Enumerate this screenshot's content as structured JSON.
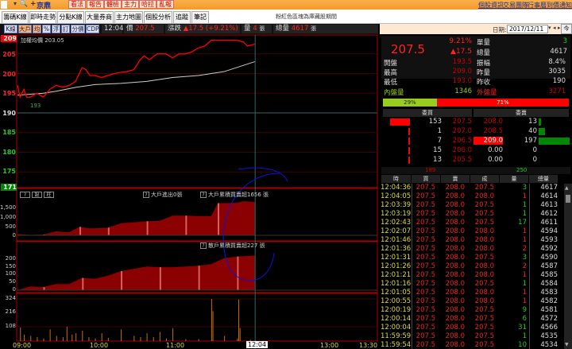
{
  "topbar": {
    "stock_name": "京鼎",
    "buttons": [
      "看法",
      "報告",
      "體檢",
      "主力",
      "哈拉",
      "亂報"
    ],
    "links": [
      "個股資訊",
      "交易團隊",
      "行事曆",
      "到價通知"
    ]
  },
  "tabs": [
    "籌碼K線",
    "即時走勢",
    "分點K線",
    "大量券商",
    "主力地圖",
    "個股分析",
    "追蹤",
    "筆記"
  ],
  "active_tab": 1,
  "notice": "粉紅色區塊為庫藏股期間",
  "toolbar": {
    "buttons": [
      "K線",
      "大戶",
      "均",
      "%",
      "浮",
      "訂",
      "分價",
      "CDP"
    ],
    "active": [
      1,
      2
    ],
    "time": "12:04",
    "price_label": "價",
    "price": "207.5",
    "change_label": "漲跌",
    "change": "▲17.5 (+9.21%)",
    "vol_label": "量",
    "vol": "4",
    "vol_unit": "張",
    "total_label": "總量",
    "total": "4617",
    "total_unit": "張"
  },
  "price_chart": {
    "avg_label": "加權均價 203.05",
    "low_marker": "193",
    "y_labels": {
      "top": "209",
      "l205": "205",
      "l200": "200",
      "l195": "195",
      "ref": "190",
      "l185": "185",
      "l180": "180",
      "l175": "175",
      "bottom": "171"
    },
    "x": [
      0,
      2,
      5,
      7,
      10,
      15,
      20,
      25,
      30,
      35,
      40,
      45,
      50,
      53,
      56,
      60,
      65,
      70,
      75,
      80,
      85,
      90,
      95,
      98,
      102,
      108,
      115,
      120,
      125,
      130,
      135,
      140,
      145,
      150,
      160,
      170,
      175,
      178,
      184
    ],
    "price": [
      197,
      194,
      196,
      194,
      194,
      195,
      194,
      196,
      197,
      196.5,
      197,
      198,
      201.5,
      201,
      199.5,
      199.5,
      199,
      199.5,
      200,
      200.3,
      200.5,
      201,
      203.5,
      204.5,
      203.5,
      205,
      205,
      204,
      205,
      205,
      205.5,
      206.5,
      207,
      208.5,
      208.5,
      208.5,
      208,
      207,
      207.5
    ],
    "avg_x": [
      0,
      20,
      30,
      45,
      60,
      80,
      100,
      120,
      140,
      160,
      184
    ],
    "avg": [
      194.5,
      195,
      195.5,
      196.5,
      197.2,
      197.5,
      198,
      199,
      199.5,
      200.5,
      203.05
    ]
  },
  "panel_buttons": [
    "?",
    "設",
    "柱"
  ],
  "big_trader": {
    "inout_label": "大戶進出0張",
    "cum_label": "大戶累積買賣超1656 張",
    "y_labels": [
      "1,500",
      "1,000",
      "500",
      "0"
    ],
    "x": [
      0,
      10,
      20,
      30,
      40,
      48,
      55,
      60,
      70,
      80,
      90,
      100,
      110,
      120,
      130,
      140,
      150,
      155,
      170,
      175,
      184
    ],
    "values": [
      60,
      20,
      40,
      200,
      150,
      420,
      350,
      350,
      380,
      600,
      650,
      700,
      720,
      980,
      980,
      960,
      960,
      1600,
      1620,
      1700,
      1656
    ]
  },
  "retail": {
    "cum_label": "散戶累積買賣超227 張",
    "y_labels": [
      "200",
      "150",
      "100",
      "50",
      "0"
    ],
    "x": [
      0,
      10,
      20,
      30,
      40,
      50,
      60,
      70,
      80,
      90,
      100,
      110,
      120,
      130,
      140,
      150,
      160,
      170,
      184
    ],
    "values": [
      0,
      25,
      20,
      40,
      40,
      80,
      75,
      95,
      125,
      140,
      155,
      150,
      150,
      155,
      160,
      170,
      210,
      220,
      227
    ]
  },
  "volume": {
    "y_labels": [
      "324",
      "216",
      "108"
    ],
    "x": [
      2,
      5,
      10,
      15,
      20,
      25,
      30,
      35,
      38,
      42,
      45,
      50,
      55,
      60,
      65,
      70,
      80,
      90,
      95,
      100,
      105,
      110,
      115,
      120,
      130,
      140,
      150,
      151,
      160,
      170,
      171,
      172,
      180
    ],
    "values": [
      105,
      50,
      40,
      30,
      20,
      90,
      40,
      30,
      110,
      50,
      60,
      80,
      30,
      20,
      60,
      25,
      90,
      40,
      30,
      60,
      30,
      70,
      20,
      100,
      15,
      15,
      324,
      230,
      40,
      20,
      320,
      100,
      10
    ]
  },
  "time_axis": [
    "09:00",
    "10:00",
    "11:00",
    "12:04",
    "13:00",
    "13:30"
  ],
  "quote": {
    "date_label": "日期:",
    "date": "2017/12/11",
    "today": "今天",
    "price": "207.5",
    "pct": "9.21%",
    "change": "▲17.5",
    "rows": [
      [
        "單量",
        "3"
      ],
      [
        "總量",
        "4617"
      ],
      [
        "開盤",
        "193.5"
      ],
      [
        "振幅",
        "8.4%"
      ],
      [
        "最高",
        "209.0"
      ],
      [
        "昨量",
        "3035"
      ],
      [
        "最低",
        "193.0"
      ],
      [
        "昨收",
        "190"
      ]
    ],
    "inner_label": "內盤量",
    "inner": "1346",
    "outer_label": "外盤量",
    "outer": "3271",
    "inner_pct": 29,
    "outer_pct": 71,
    "inner_pct_label": "29%",
    "outer_pct_label": "71%"
  },
  "orderbook": {
    "bid_header": "委買",
    "ask_header": "委賣",
    "rows": [
      [
        "153",
        "207.5",
        "208.0",
        "13"
      ],
      [
        "1",
        "207.0",
        "208.5",
        "40"
      ],
      [
        "7",
        "206.5",
        "209.0",
        "197"
      ],
      [
        "15",
        "206.0",
        "0.00",
        "0"
      ],
      [
        "13",
        "205.5",
        "0.00",
        "0"
      ]
    ],
    "bid_total": "189",
    "ask_total": "250"
  },
  "ticks": {
    "headers": [
      "時",
      "買",
      "賣",
      "成",
      "量",
      "總量"
    ],
    "rows": [
      [
        "12:04:36",
        "207.5",
        "208.0",
        "207.5",
        "3",
        "4617"
      ],
      [
        "12:04:05",
        "207.5",
        "208.0",
        "208.0",
        "1",
        "4614"
      ],
      [
        "12:03:39",
        "207.5",
        "208.0",
        "207.5",
        "1",
        "4613"
      ],
      [
        "12:03:19",
        "207.5",
        "208.0",
        "207.5",
        "1",
        "4612"
      ],
      [
        "12:02:43",
        "207.5",
        "208.0",
        "207.5",
        "17",
        "4611"
      ],
      [
        "12:02:07",
        "207.5",
        "208.0",
        "208.0",
        "1",
        "4594"
      ],
      [
        "12:01:46",
        "207.5",
        "208.0",
        "208.0",
        "1",
        "4593"
      ],
      [
        "12:01:36",
        "207.5",
        "208.0",
        "208.0",
        "2",
        "4592"
      ],
      [
        "12:01:31",
        "207.5",
        "208.0",
        "207.5",
        "3",
        "4590"
      ],
      [
        "12:01:26",
        "207.5",
        "208.0",
        "208.0",
        "2",
        "4587"
      ],
      [
        "12:01:21",
        "207.5",
        "208.0",
        "208.0",
        "1",
        "4585"
      ],
      [
        "12:01:16",
        "207.5",
        "208.0",
        "207.5",
        "1",
        "4584"
      ],
      [
        "12:01:05",
        "207.5",
        "208.0",
        "208.0",
        "1",
        "4583"
      ],
      [
        "12:00:55",
        "207.5",
        "208.0",
        "208.0",
        "1",
        "4582"
      ],
      [
        "12:00:19",
        "207.5",
        "208.0",
        "207.5",
        "9",
        "4581"
      ],
      [
        "12:00:14",
        "207.5",
        "208.0",
        "207.5",
        "6",
        "4572"
      ],
      [
        "12:00:04",
        "207.5",
        "208.0",
        "207.5",
        "31",
        "4566"
      ],
      [
        "11:59:59",
        "207.5",
        "208.0",
        "207.5",
        "1",
        "4535"
      ],
      [
        "11:59:54",
        "207.5",
        "208.0",
        "207.5",
        "10",
        "4534"
      ]
    ]
  },
  "colors": {
    "up": "#ff2020",
    "down": "#22cc22",
    "area": "#8b0000",
    "area_light": "#d86060",
    "vol": "#c86a10",
    "accent": "#f39a2a"
  }
}
